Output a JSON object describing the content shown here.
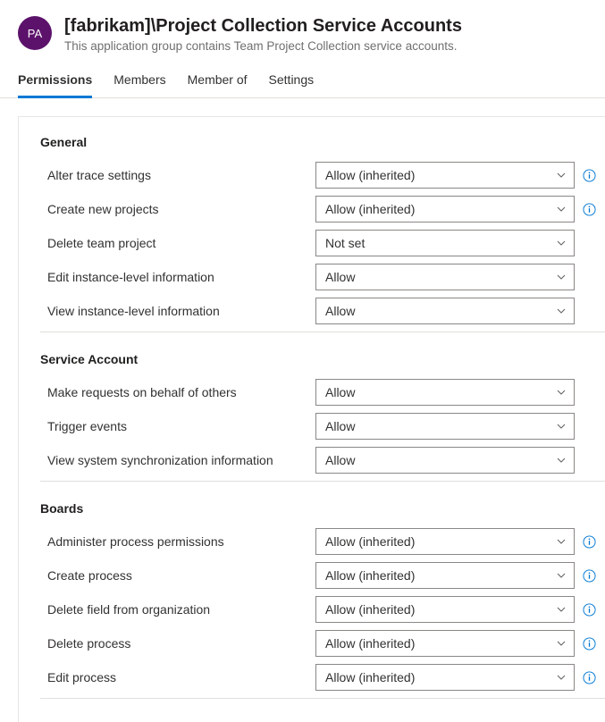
{
  "header": {
    "avatar_initials": "PA",
    "title": "[fabrikam]\\Project Collection Service Accounts",
    "subtitle": "This application group contains Team Project Collection service accounts."
  },
  "tabs": [
    {
      "label": "Permissions",
      "active": true
    },
    {
      "label": "Members",
      "active": false
    },
    {
      "label": "Member of",
      "active": false
    },
    {
      "label": "Settings",
      "active": false
    }
  ],
  "sections": [
    {
      "title": "General",
      "rows": [
        {
          "label": "Alter trace settings",
          "value": "Allow (inherited)",
          "info": true
        },
        {
          "label": "Create new projects",
          "value": "Allow (inherited)",
          "info": true
        },
        {
          "label": "Delete team project",
          "value": "Not set",
          "info": false
        },
        {
          "label": "Edit instance-level information",
          "value": "Allow",
          "info": false
        },
        {
          "label": "View instance-level information",
          "value": "Allow",
          "info": false
        }
      ]
    },
    {
      "title": "Service Account",
      "rows": [
        {
          "label": "Make requests on behalf of others",
          "value": "Allow",
          "info": false
        },
        {
          "label": "Trigger events",
          "value": "Allow",
          "info": false
        },
        {
          "label": "View system synchronization information",
          "value": "Allow",
          "info": false
        }
      ]
    },
    {
      "title": "Boards",
      "rows": [
        {
          "label": "Administer process permissions",
          "value": "Allow (inherited)",
          "info": true
        },
        {
          "label": "Create process",
          "value": "Allow (inherited)",
          "info": true
        },
        {
          "label": "Delete field from organization",
          "value": "Allow (inherited)",
          "info": true
        },
        {
          "label": "Delete process",
          "value": "Allow (inherited)",
          "info": true
        },
        {
          "label": "Edit process",
          "value": "Allow (inherited)",
          "info": true
        }
      ]
    }
  ]
}
